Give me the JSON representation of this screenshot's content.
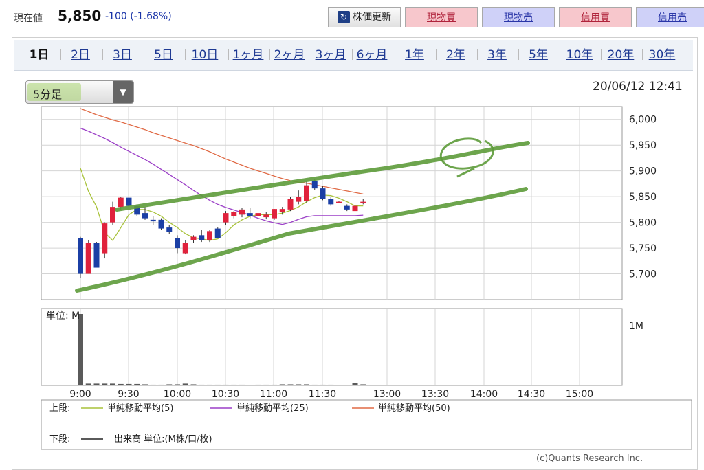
{
  "header": {
    "price_label": "現在値",
    "price": "5,850",
    "change": "-100 (-1.68%)",
    "refresh_button": "株価更新",
    "buttons": [
      {
        "label": "現物買",
        "kind": "buy"
      },
      {
        "label": "現物売",
        "kind": "sell"
      },
      {
        "label": "信用買",
        "kind": "buy"
      },
      {
        "label": "信用売",
        "kind": "sell"
      }
    ]
  },
  "period_tabs": [
    "1日",
    "2日",
    "3日",
    "5日",
    "10日",
    "1ヶ月",
    "2ヶ月",
    "3ヶ月",
    "6ヶ月",
    "1年",
    "2年",
    "3年",
    "5年",
    "10年",
    "20年",
    "30年"
  ],
  "active_tab": "1日",
  "interval_select": "5分足",
  "timestamp_date": "20/06/12",
  "timestamp_time": "12:41",
  "copyright": "(c)Quants Research Inc.",
  "colors": {
    "up": "#e0223c",
    "down": "#1b3fa5",
    "ma5": "#a8c23a",
    "ma25": "#9b3fc7",
    "ma50": "#e06a45",
    "volume": "#5a5a5a",
    "annotation": "#5d9b3a"
  },
  "chart_data": {
    "type": "candlestick",
    "x_ticks": [
      "9:00",
      "9:30",
      "10:00",
      "10:30",
      "11:00",
      "11:30",
      "13:00",
      "13:30",
      "14:00",
      "14:30",
      "15:00"
    ],
    "ylim": [
      5650,
      6025
    ],
    "y_ticks": [
      5700,
      5750,
      5800,
      5850,
      5900,
      5950,
      6000
    ],
    "y_tick_labels": [
      "5,700",
      "5,750",
      "5,800",
      "5,850",
      "5,900",
      "5,950",
      "6,000"
    ],
    "candles": [
      {
        "time": "9:00",
        "o": 5770,
        "h": 5772,
        "l": 5692,
        "c": 5700
      },
      {
        "time": "9:05",
        "o": 5700,
        "h": 5765,
        "l": 5700,
        "c": 5760
      },
      {
        "time": "9:10",
        "o": 5760,
        "h": 5762,
        "l": 5712,
        "c": 5712
      },
      {
        "time": "9:15",
        "o": 5740,
        "h": 5800,
        "l": 5730,
        "c": 5798
      },
      {
        "time": "9:20",
        "o": 5800,
        "h": 5840,
        "l": 5795,
        "c": 5830
      },
      {
        "time": "9:25",
        "o": 5830,
        "h": 5850,
        "l": 5825,
        "c": 5848
      },
      {
        "time": "9:30",
        "o": 5848,
        "h": 5852,
        "l": 5830,
        "c": 5832
      },
      {
        "time": "9:35",
        "o": 5832,
        "h": 5835,
        "l": 5812,
        "c": 5815
      },
      {
        "time": "9:40",
        "o": 5818,
        "h": 5830,
        "l": 5805,
        "c": 5808
      },
      {
        "time": "9:45",
        "o": 5805,
        "h": 5812,
        "l": 5795,
        "c": 5802
      },
      {
        "time": "9:50",
        "o": 5805,
        "h": 5808,
        "l": 5785,
        "c": 5788
      },
      {
        "time": "9:55",
        "o": 5790,
        "h": 5795,
        "l": 5778,
        "c": 5781
      },
      {
        "time": "10:00",
        "o": 5770,
        "h": 5775,
        "l": 5740,
        "c": 5750
      },
      {
        "time": "10:05",
        "o": 5740,
        "h": 5765,
        "l": 5738,
        "c": 5760
      },
      {
        "time": "10:10",
        "o": 5765,
        "h": 5775,
        "l": 5760,
        "c": 5772
      },
      {
        "time": "10:15",
        "o": 5775,
        "h": 5785,
        "l": 5762,
        "c": 5765
      },
      {
        "time": "10:20",
        "o": 5765,
        "h": 5785,
        "l": 5762,
        "c": 5783
      },
      {
        "time": "10:25",
        "o": 5788,
        "h": 5790,
        "l": 5770,
        "c": 5770
      },
      {
        "time": "10:30",
        "o": 5800,
        "h": 5822,
        "l": 5795,
        "c": 5818
      },
      {
        "time": "10:35",
        "o": 5812,
        "h": 5822,
        "l": 5808,
        "c": 5820
      },
      {
        "time": "10:40",
        "o": 5815,
        "h": 5828,
        "l": 5810,
        "c": 5825
      },
      {
        "time": "10:45",
        "o": 5818,
        "h": 5828,
        "l": 5808,
        "c": 5812
      },
      {
        "time": "10:50",
        "o": 5812,
        "h": 5825,
        "l": 5808,
        "c": 5818
      },
      {
        "time": "10:55",
        "o": 5810,
        "h": 5820,
        "l": 5806,
        "c": 5815
      },
      {
        "time": "11:00",
        "o": 5808,
        "h": 5826,
        "l": 5805,
        "c": 5826
      },
      {
        "time": "11:05",
        "o": 5820,
        "h": 5830,
        "l": 5815,
        "c": 5826
      },
      {
        "time": "11:10",
        "o": 5825,
        "h": 5850,
        "l": 5822,
        "c": 5845
      },
      {
        "time": "11:15",
        "o": 5840,
        "h": 5862,
        "l": 5835,
        "c": 5850
      },
      {
        "time": "11:20",
        "o": 5842,
        "h": 5880,
        "l": 5838,
        "c": 5872
      },
      {
        "time": "11:25",
        "o": 5880,
        "h": 5885,
        "l": 5863,
        "c": 5866
      },
      {
        "time": "11:30",
        "o": 5866,
        "h": 5870,
        "l": 5843,
        "c": 5846
      },
      {
        "time": "11:35",
        "o": 5845,
        "h": 5850,
        "l": 5832,
        "c": 5835
      },
      {
        "time": "11:40",
        "o": 5840,
        "h": 5842,
        "l": 5838,
        "c": 5840
      },
      {
        "time": "11:45",
        "o": 5832,
        "h": 5835,
        "l": 5822,
        "c": 5825
      },
      {
        "time": "11:50",
        "o": 5822,
        "h": 5835,
        "l": 5808,
        "c": 5832
      },
      {
        "time": "11:55",
        "o": 5840,
        "h": 5845,
        "l": 5835,
        "c": 5840
      }
    ],
    "ma5": [
      5905,
      5860,
      5830,
      5780,
      5765,
      5790,
      5815,
      5825,
      5825,
      5820,
      5812,
      5800,
      5790,
      5778,
      5770,
      5768,
      5765,
      5768,
      5780,
      5795,
      5805,
      5812,
      5815,
      5815,
      5815,
      5818,
      5823,
      5830,
      5840,
      5848,
      5853,
      5852,
      5847,
      5840,
      5832,
      5832
    ],
    "ma25": [
      5983,
      5977,
      5970,
      5963,
      5955,
      5946,
      5938,
      5930,
      5922,
      5913,
      5903,
      5893,
      5883,
      5873,
      5862,
      5852,
      5843,
      5835,
      5829,
      5824,
      5819,
      5814,
      5808,
      5803,
      5799,
      5796,
      5800,
      5806,
      5811,
      5813,
      5813,
      5813,
      5813,
      5813,
      5813,
      5814
    ],
    "ma50": [
      6021,
      6015,
      6009,
      6004,
      5999,
      5995,
      5990,
      5985,
      5980,
      5974,
      5969,
      5964,
      5959,
      5954,
      5949,
      5943,
      5937,
      5930,
      5923,
      5917,
      5911,
      5905,
      5900,
      5895,
      5890,
      5885,
      5881,
      5878,
      5876,
      5873,
      5870,
      5867,
      5864,
      5861,
      5858,
      5855
    ],
    "volume_label": "単位: M",
    "volume_tick": "1M",
    "volume": [
      1.0,
      0.025,
      0.025,
      0.025,
      0.025,
      0.02,
      0.02,
      0.02,
      0.015,
      0.01,
      0.01,
      0.015,
      0.015,
      0.025,
      0.015,
      0.01,
      0.01,
      0.01,
      0.01,
      0.01,
      0.01,
      0.005,
      0.01,
      0.01,
      0.01,
      0.015,
      0.015,
      0.015,
      0.015,
      0.01,
      0.01,
      0.01,
      0.005,
      0.005,
      0.035,
      0.015
    ],
    "legend_upper_label": "上段:",
    "legend_lower_label": "下段:",
    "series": [
      {
        "name": "単純移動平均(5)",
        "key": "ma5"
      },
      {
        "name": "単純移動平均(25)",
        "key": "ma25"
      },
      {
        "name": "単純移動平均(50)",
        "key": "ma50"
      }
    ],
    "volume_legend": "出来高 単位:(M株/口/枚)"
  }
}
